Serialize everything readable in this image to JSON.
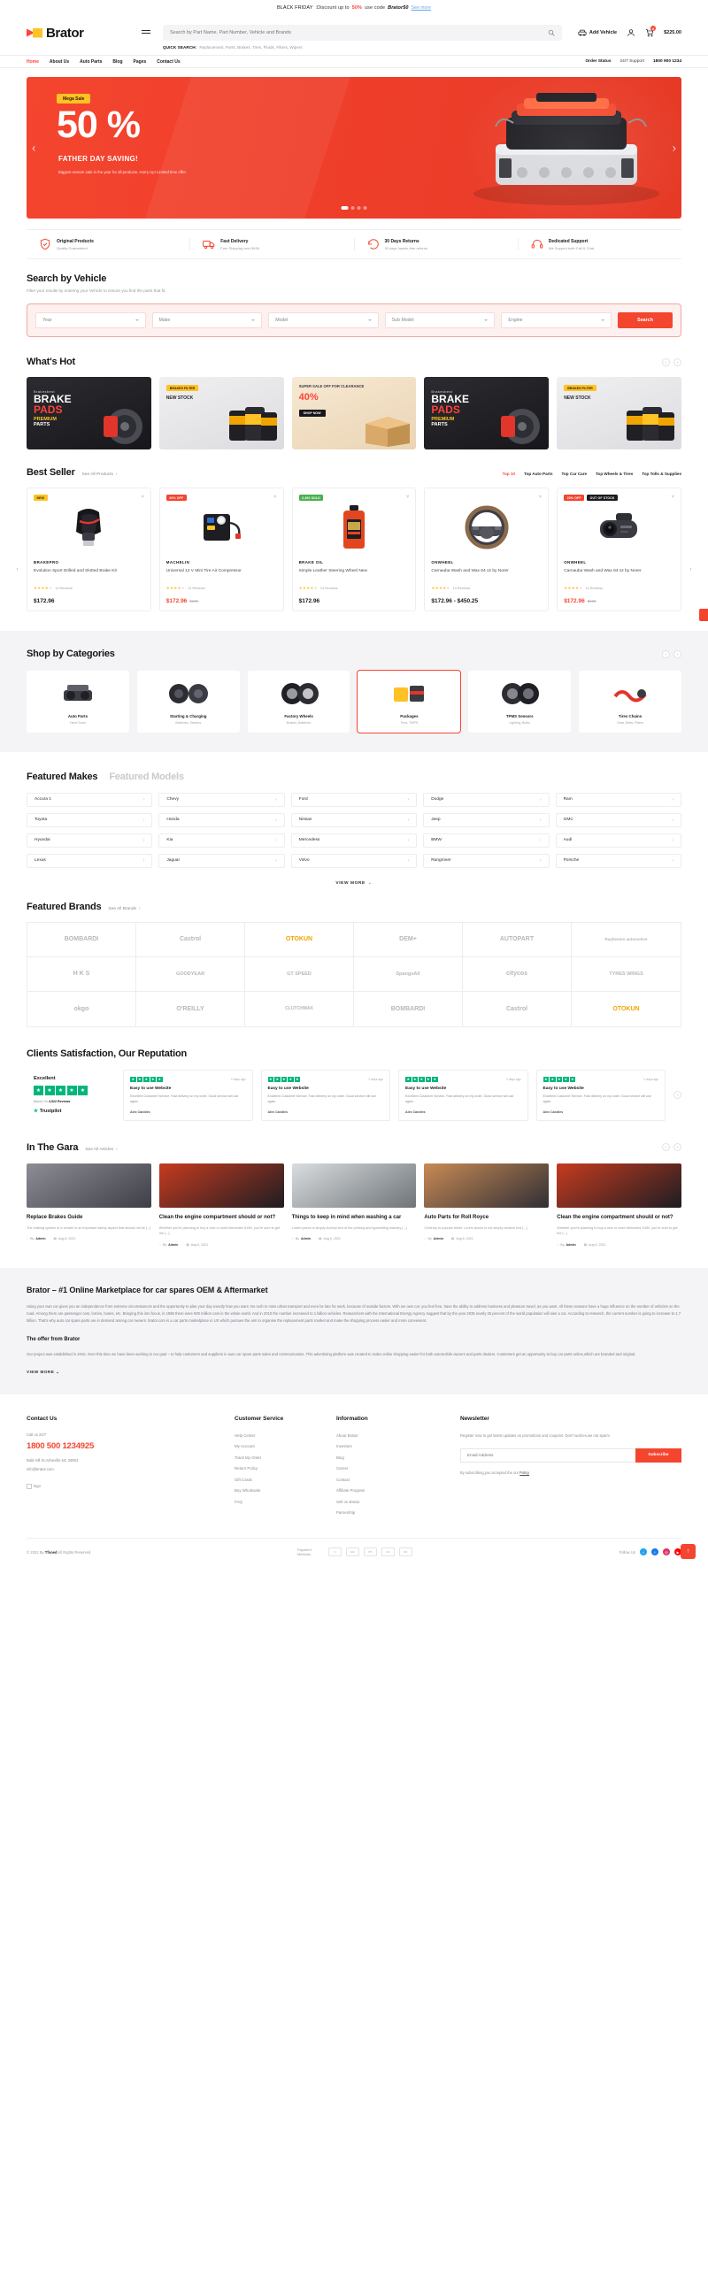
{
  "promo": {
    "label": "BLACK FRIDAY",
    "text": ":Discount up to",
    "percent": "50%",
    "text2": "use code",
    "code": "Brator50",
    "link": "See more"
  },
  "header": {
    "logo_text": "Brator",
    "search_placeholder": "Search by Part Name, Part Number, Vehicle and Brands",
    "quick_search_label": "QUICK SEARCH:",
    "quick_search_items": "Replacement, Parts, Brakes, Tires, Fluids, Filters, Wipers",
    "add_vehicle": "Add Vehicle",
    "cart_count": "0",
    "cart_total": "$225.00"
  },
  "nav": {
    "items": [
      {
        "label": "Home",
        "active": true
      },
      {
        "label": "About Us",
        "active": false
      },
      {
        "label": "Auto Parts",
        "active": false
      },
      {
        "label": "Blog",
        "active": false
      },
      {
        "label": "Pages",
        "active": false
      },
      {
        "label": "Contact Us",
        "active": false
      }
    ],
    "order_status": "Order Status",
    "support_label": "24/7 Support",
    "support_phone": "1800 900 1234"
  },
  "hero": {
    "badge": "Mega Sale",
    "headline": "50 %",
    "subline": "FATHER DAY  SAVING!",
    "desc": "Biggest season sale in the year for all products. Hurry Up! Limited time offer."
  },
  "usps": [
    {
      "icon": "shield-check-icon",
      "title": "Original Products",
      "sub": "Quality Guaranteed"
    },
    {
      "icon": "truck-icon",
      "title": "Fast Delivery",
      "sub": "Free Shipping over $499"
    },
    {
      "icon": "return-icon",
      "title": "30 Days Returns",
      "sub": "30 days hassle-free returns"
    },
    {
      "icon": "headset-icon",
      "title": "Dedicated Support",
      "sub": "We Support both Call & Chat"
    }
  ],
  "search_vehicle": {
    "title": "Search by Vehicle",
    "subtitle": "Filter your results by entering your Vehicle to ensure you find the parts that fit.",
    "fields": [
      {
        "label": "Year"
      },
      {
        "label": "Make"
      },
      {
        "label": "Model"
      },
      {
        "label": "Sub Model"
      },
      {
        "label": "Engine"
      }
    ],
    "button": "Search"
  },
  "whats_hot": {
    "title": "What's Hot",
    "cards": [
      {
        "kind": "brake",
        "pre": "Brakesbest",
        "l2": "BRAKE",
        "l3": "PADS",
        "l4": "PREMIUM",
        "l5": "PARTS"
      },
      {
        "kind": "filter",
        "tag": "BRAKES FILTER",
        "tag2": "NEW STOCK"
      },
      {
        "kind": "sale",
        "s1": "SUPER SALE OFF FOR CLEARANCE",
        "s2": "40%",
        "s3": "SHOP NOW"
      },
      {
        "kind": "brake",
        "pre": "Brakesbest",
        "l2": "BRAKE",
        "l3": "PADS",
        "l4": "PREMIUM",
        "l5": "PARTS"
      },
      {
        "kind": "filter",
        "tag": "BRAKES FILTER",
        "tag2": "NEW STOCK"
      }
    ]
  },
  "best_seller": {
    "title": "Best Seller",
    "see_all": "See All Products",
    "tabs": [
      {
        "label": "Top 10",
        "active": true
      },
      {
        "label": "Top Auto Parts",
        "active": false
      },
      {
        "label": "Top Car Care",
        "active": false
      },
      {
        "label": "Top Wheels & Tires",
        "active": false
      },
      {
        "label": "Top Tolls & Supplies",
        "active": false
      }
    ],
    "products": [
      {
        "badges": [
          {
            "text": "NEW",
            "style": "b-new"
          }
        ],
        "brand": "BRAKEPRO",
        "name": "Evolution Sport Drilled and Slotted Brake Kit",
        "reviews": "14 Reviews",
        "price": "$172.96",
        "old_price": "",
        "price_red": false,
        "image": "gear-shift-knob"
      },
      {
        "badges": [
          {
            "text": "20% OFF",
            "style": "b-off"
          }
        ],
        "brand": "MACHELIN",
        "name": "Universal 12 V Mini Tire Air Compressor",
        "reviews": "14 Reviews",
        "price": "$172.96",
        "old_price": "$195",
        "price_red": true,
        "image": "air-compressor"
      },
      {
        "badges": [
          {
            "text": "2,360 SOLD",
            "style": "b-sold"
          }
        ],
        "brand": "BRAKE OIL",
        "name": "Simple Leather Steering Wheel New",
        "reviews": "14 Reviews",
        "price": "$172.96",
        "old_price": "",
        "price_red": false,
        "image": "car-wash-bottle"
      },
      {
        "badges": [],
        "brand": "ONWHEEL",
        "name": "Carnauba Wash and Wax 64 oz by Norer",
        "reviews": "14 Reviews",
        "price": "$172.96 - $450.25",
        "old_price": "",
        "price_red": false,
        "image": "steering-wheel"
      },
      {
        "badges": [
          {
            "text": "20% OFF",
            "style": "b-off"
          },
          {
            "text": "OUT OF STOCK",
            "style": "b-oos"
          }
        ],
        "brand": "ONWHEEL",
        "name": "Carnauba Wash and Wax 64 oz by Norer",
        "reviews": "14 Reviews",
        "price": "$172.96",
        "old_price": "$195",
        "price_red": true,
        "image": "dash-cam"
      }
    ]
  },
  "categories": {
    "title": "Shop by Categories",
    "items": [
      {
        "name": "Auto Parts",
        "sub": "Hand Tools"
      },
      {
        "name": "Starting & Charging",
        "sub": "Batteries, Starters"
      },
      {
        "name": "Factory Wheels",
        "sub": "Brakes, Batteries"
      },
      {
        "name": "Packages",
        "sub": "Tires, TMPS"
      },
      {
        "name": "TPMS Sensors",
        "sub": "Lighting, Bulbs"
      },
      {
        "name": "Tires Chains",
        "sub": "Gear, Belts, Filters"
      }
    ]
  },
  "makes": {
    "tab_makes": "Featured Makes",
    "tab_models": "Featured Models",
    "items": [
      "Accura 1",
      "Chevy",
      "Ford",
      "Dodge",
      "Ram",
      "Toyota",
      "Honda",
      "Nissan",
      "Jeep",
      "GMC",
      "Hyundai",
      "Kia",
      "Mercedess",
      "BMW",
      "Audi",
      "Lexus",
      "Jaguar",
      "Volvo",
      "Rangrover",
      "Porsche"
    ],
    "view_more": "VIEW MORE"
  },
  "brands": {
    "title": "Featured Brands",
    "see_all": "See All Brands",
    "items": [
      "BOMBARDI",
      "Castrol",
      "OTOKUN",
      "DEM+",
      "AUTOPART",
      "Raybestos automotive",
      "H K S",
      "GOODYEAR",
      "GT SPEED",
      "SpangoAll",
      "citycos",
      "TYRES WINGS",
      "okgo",
      "O'REILLY",
      "CLUTCHMAX",
      "BOMBARDI",
      "Castrol",
      "OTOKUN"
    ]
  },
  "reviews": {
    "title": "Clients Satisfaction, Our Reputation",
    "score_label": "Excellent",
    "rated_text": "Based On",
    "rated_count": "4,522 Reviews",
    "trustpilot": "Trustpilot",
    "items": [
      {
        "ago": "2 days ago",
        "title": "Easy to use Website",
        "body": "Excellent Customer Service. Fast delivery on my order. Good service will use again.",
        "name": "Alex Candles"
      },
      {
        "ago": "2 days ago",
        "title": "Easy to use Website",
        "body": "Excellent Customer Service. Fast delivery on my order. Good service will use again.",
        "name": "Alex Candles"
      },
      {
        "ago": "2 days ago",
        "title": "Easy to use Website",
        "body": "Excellent Customer Service. Fast delivery on my order. Good service will use again.",
        "name": "Alex Candles"
      },
      {
        "ago": "2 days ago",
        "title": "Easy to use Website",
        "body": "Excellent Customer Service. Fast delivery on my order. Good service will use again.",
        "name": "Alex Candles"
      }
    ]
  },
  "blog": {
    "title": "In The Gara",
    "see_all": "See All Articles",
    "posts": [
      {
        "title": "Replace Brakes Guide",
        "excerpt": "The braking system of a vehicle is an important safety aspect that should not be [...]",
        "author": "Admin",
        "date": "Aug 6, 2021",
        "img": "i1"
      },
      {
        "title": "Clean the engine compartment should or not?",
        "excerpt": "Whether you're planning to buy a new or used Mercedes S450, you're sure to get the [...]",
        "author": "Admin",
        "date": "Aug 6, 2021",
        "img": "i2"
      },
      {
        "title": "Things to keep in mind when washing a car",
        "excerpt": "Lorem Ipsum is simply dummy text of the printing and typesetting industry [...]",
        "author": "Admin",
        "date": "Aug 6, 2021",
        "img": "i3"
      },
      {
        "title": "Auto Parts for Roll Royce",
        "excerpt": "Contrary to popular belief, Lorem Ipsum is not simply random text [...]",
        "author": "Admin",
        "date": "Aug 6, 2021",
        "img": "i4"
      },
      {
        "title": "Clean the engine compartment should or not?",
        "excerpt": "Whether you're planning to buy a new or used Mercedes S450, you're sure to get the [...]",
        "author": "Admin",
        "date": "Aug 6, 2021",
        "img": "i5"
      }
    ]
  },
  "seo": {
    "title": "Brator – #1 Online Marketplace for car spares OEM & Aftermarket",
    "p1": "Using your own car gives you an independence from extreme circumstances and the opportunity to plan your day exactly how you want. No rush to miss urban transport and even be late for work, because of outside factors. With we own car, you feel free, have the ability to address business and pleasure travel, as you want. All these reasons have a huge influence on the number of vehicles on the road. Among them are passenger cars, lorries, buses, etc. Bringing this into focus, in 1986 there were 500 million cars in the whole world. And in 2010 the number increased to 1 billion vehicles. Researchers with the International Energy Agency suggest that by the year 2035 nearly 25 percent of the world population will own a car. According to research, the current number is going to increase to 1.7 billion. That's why auto car spare parts are in demand among car owners. brator.com is a car parts marketplace in US which pursues the aim to organise the replacement parts market and make the shopping process easier and more convenient.",
    "h3": "The offer from Brator",
    "p2": "Our project was established in 2015. Over this time we have been working in our goal – to help customers and suppliers in auto car spare parts sales and communication. This advertising platform was created to make online shopping easier for both automobile owners and parts dealers. Customers get an opportunity to buy car parts online,which are branded and original.",
    "view_more": "VIEW MORE"
  },
  "footer": {
    "contact": {
      "heading": "Contact Us",
      "call_label": "Call us 24/7",
      "phone": "1800 500 1234925",
      "address": "Bald Hill St,Asheville,NC 28803",
      "email": "info@brator.com",
      "logo_alt": "logo"
    },
    "customer_service": {
      "heading": "Customer Service",
      "links": [
        "Help Center",
        "My Account",
        "Track My Order",
        "Return Policy",
        "Gift Cards",
        "Buy Wholesale",
        "FAQ"
      ]
    },
    "information": {
      "heading": "Information",
      "links": [
        "About Brator",
        "Investors",
        "Blog",
        "Career",
        "Contact",
        "Affiliate Program",
        "Sell on Brator",
        "Parnership"
      ]
    },
    "newsletter": {
      "heading": "Newsletter",
      "desc": "Register now to get latest updates on promotions and coupons. Don't worries,we not spam!",
      "placeholder": "Email Address",
      "button": "Subscribe",
      "note": "By subscribing,you accepted the our",
      "note_link": "Policy"
    }
  },
  "bottom": {
    "copyright_pre": "© 2022 By",
    "copyright_brand": "Tfsoed",
    "copyright_post": "All Rights Reserved",
    "pay_label": "Payment Methods",
    "pay_chips": [
      "visa",
      "mastercard",
      "paypal",
      "amex",
      "discover"
    ],
    "follow_label": "Follow Us",
    "social": [
      "twitter",
      "facebook",
      "instagram",
      "youtube"
    ],
    "to_top": "↑"
  }
}
